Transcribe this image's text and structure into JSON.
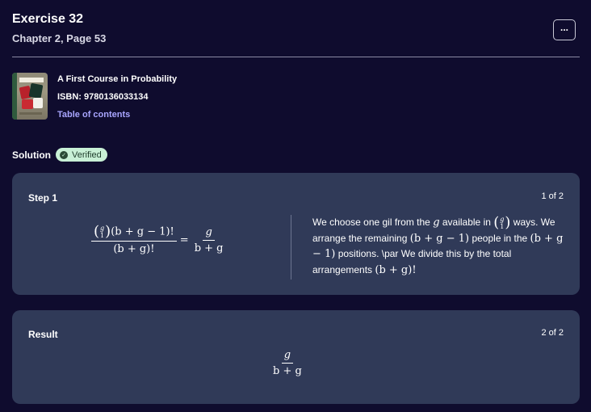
{
  "header": {
    "title": "Exercise 32",
    "subtitle": "Chapter 2, Page 53",
    "more_label": "..."
  },
  "book": {
    "title": "A First Course in Probability",
    "isbn": "ISBN: 9780136033134",
    "toc_link": "Table of contents",
    "cover_title": "PROBABILITY"
  },
  "solution": {
    "label": "Solution",
    "badge": "Verified",
    "badge_icon": "check-circle-icon"
  },
  "step": {
    "label": "Step 1",
    "count": "1 of 2",
    "formula": {
      "binom_top": "g",
      "binom_bottom": "1",
      "numerator_rest": "(b + g − 1)!",
      "denominator": "(b + g)!",
      "rhs_num": "g",
      "rhs_den": "b + g"
    },
    "explanation": {
      "p1": "We choose one gil from the ",
      "v_g": "g",
      "p2": " available in ",
      "binom_top": "g",
      "binom_bottom": "1",
      "p3": " ways. We arrange the remaining ",
      "m1": "(b + g − 1)",
      "p4": " people in the ",
      "m2": "(b + g − 1)",
      "p5": " positions. \\par We divide this by the total arrangements ",
      "m3": "(b + g)!"
    }
  },
  "result": {
    "label": "Result",
    "count": "2 of 2",
    "num": "g",
    "den": "b + g"
  },
  "colors": {
    "background": "#0f0c2e",
    "card": "#303a58",
    "link": "#a9a6ff",
    "verified_bg": "#c8f0d6"
  }
}
